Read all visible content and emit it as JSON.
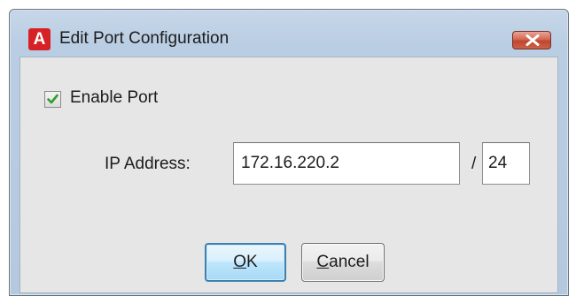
{
  "window": {
    "title": "Edit Port Configuration",
    "app_icon_letter": "A",
    "app_icon_color": "#d62226"
  },
  "titlebar": {
    "close_icon": "close-icon"
  },
  "form": {
    "enable_port_label": "Enable Port",
    "enable_port_checked": true,
    "ip_address_label": "IP Address:",
    "ip_address_value": "172.16.220.2",
    "separator": "/",
    "prefix_value": "24"
  },
  "buttons": {
    "ok_mnemonic": "O",
    "ok_rest": "K",
    "cancel_mnemonic": "C",
    "cancel_rest": "ancel"
  },
  "colors": {
    "title_bar": "#b9cde3",
    "client_bg": "#e6e6e6",
    "check_mark": "#2e9e2e",
    "close_button": "#c0462f"
  }
}
